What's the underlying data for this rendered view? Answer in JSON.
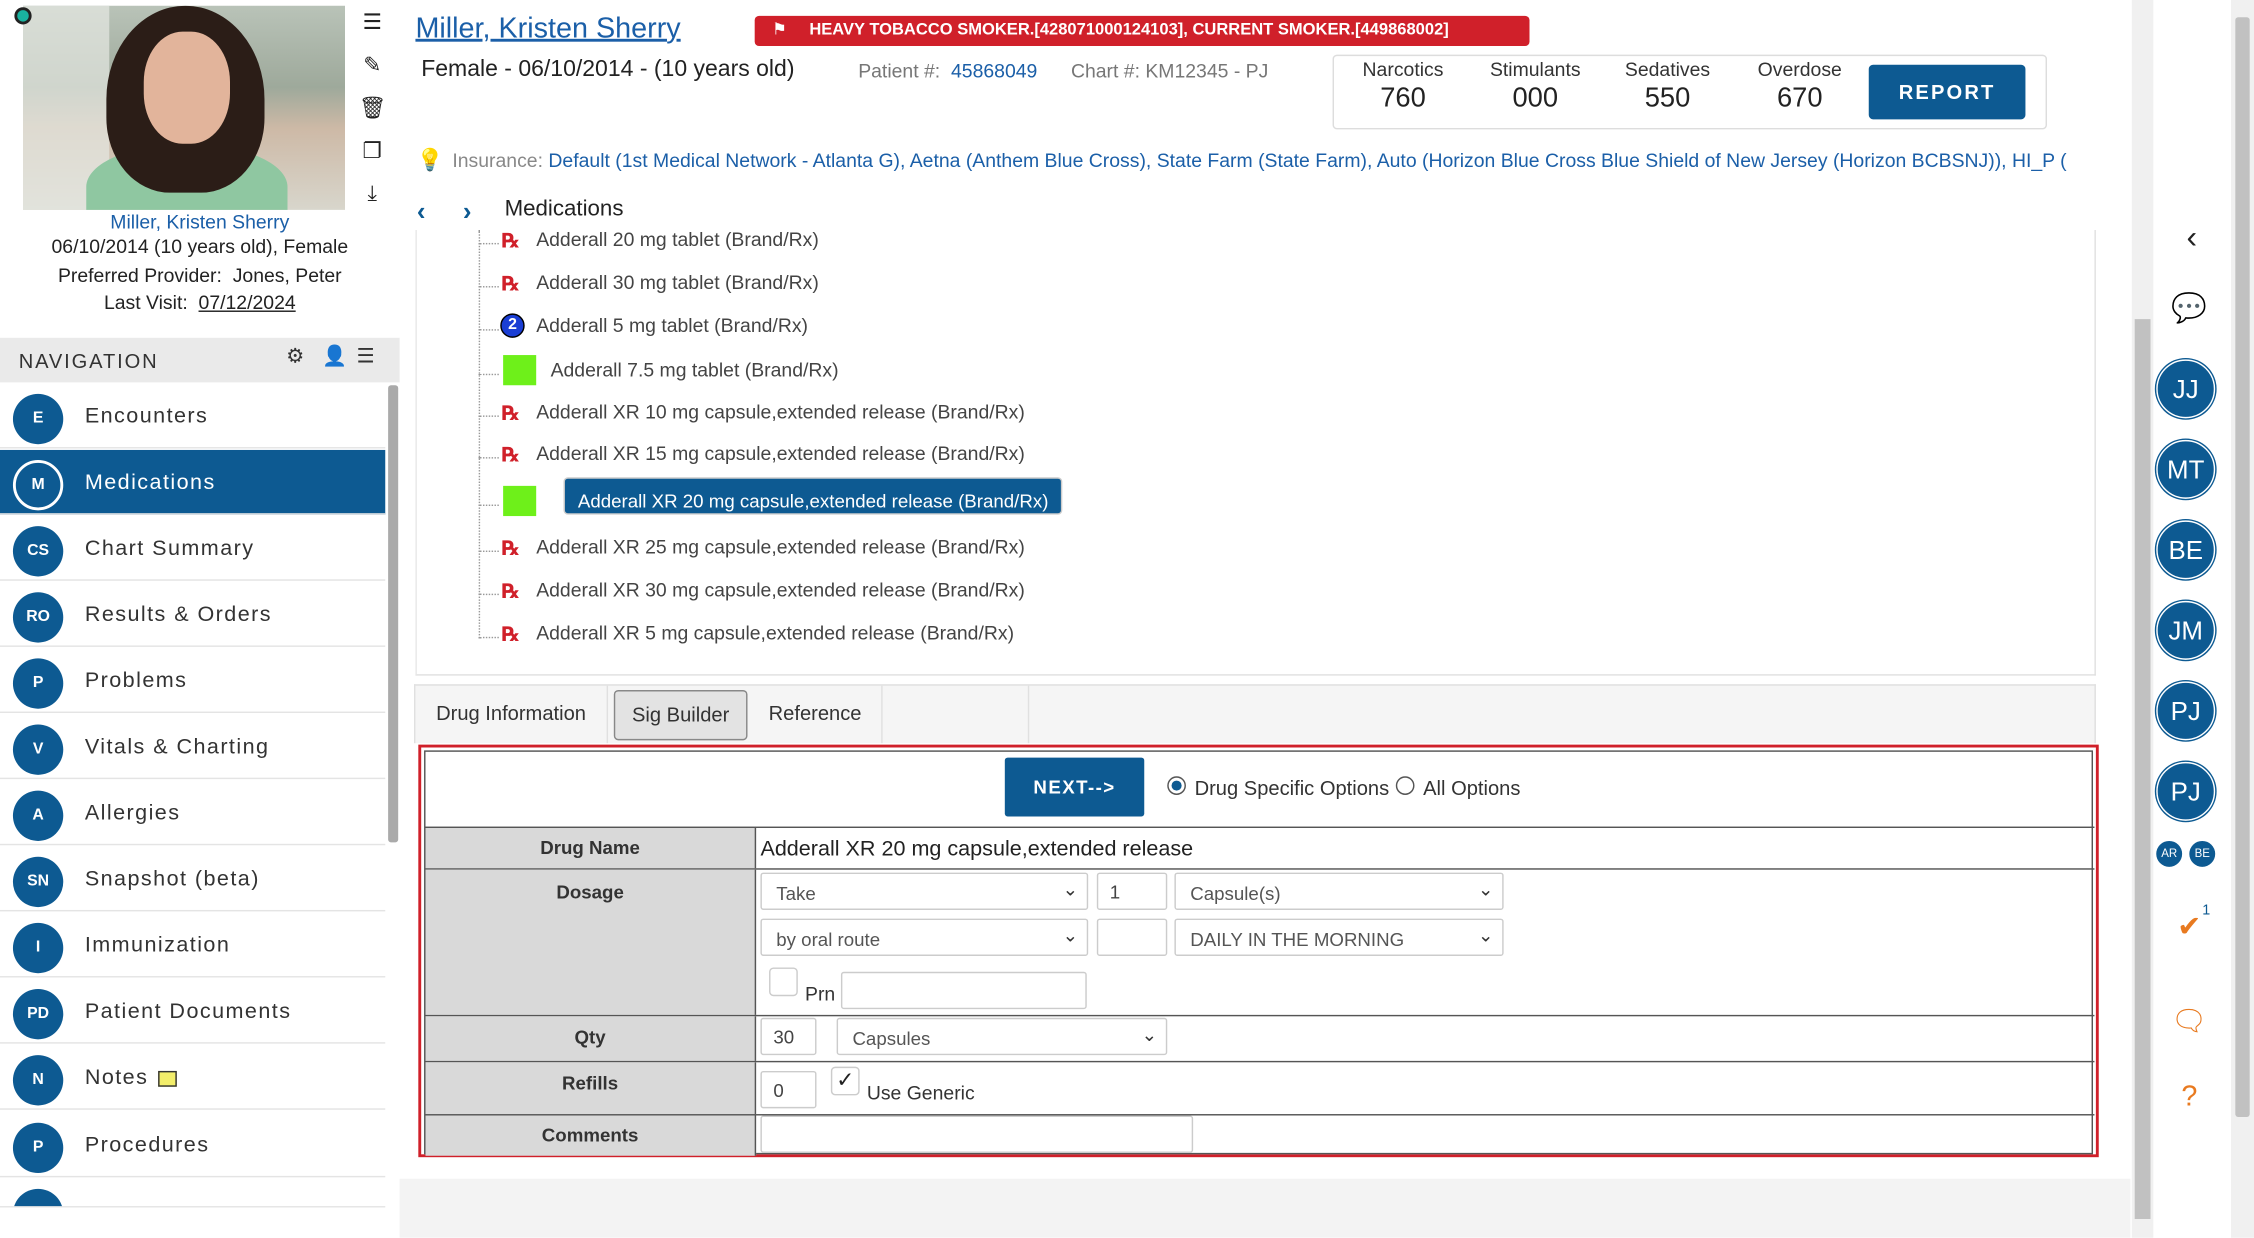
{
  "patient": {
    "name": "Miller, Kristen Sherry",
    "card_name": "Miller, Kristen Sherry",
    "dob_line": "06/10/2014 (10 years old), Female",
    "provider_label": "Preferred Provider:",
    "provider_value": "Jones, Peter",
    "last_visit_label": "Last Visit:",
    "last_visit_value": "07/12/2024",
    "demographics": "Female - 06/10/2014 - (10 years old)",
    "patient_num_label": "Patient #:",
    "patient_num_value": "45868049",
    "chart_num": "Chart #: KM12345 - PJ"
  },
  "flag_text": "HEAVY TOBACCO SMOKER.[428071000124103], CURRENT SMOKER.[449868002]",
  "pdmp": {
    "narcotics_label": "Narcotics",
    "narcotics_value": "760",
    "stimulants_label": "Stimulants",
    "stimulants_value": "000",
    "sedatives_label": "Sedatives",
    "sedatives_value": "550",
    "overdose_label": "Overdose",
    "overdose_value": "670",
    "report_label": "REPORT"
  },
  "insurance": {
    "label": "Insurance:",
    "value": "Default (1st Medical Network - Atlanta G), Aetna (Anthem Blue Cross), State Farm (State Farm), Auto (Horizon Blue Cross Blue Shield of New Jersey (Horizon BCBSNJ)), HI_P ("
  },
  "navigation": {
    "title": "NAVIGATION",
    "items": [
      {
        "abbr": "E",
        "label": "Encounters"
      },
      {
        "abbr": "M",
        "label": "Medications"
      },
      {
        "abbr": "CS",
        "label": "Chart Summary"
      },
      {
        "abbr": "RO",
        "label": "Results & Orders"
      },
      {
        "abbr": "P",
        "label": "Problems"
      },
      {
        "abbr": "V",
        "label": "Vitals & Charting"
      },
      {
        "abbr": "A",
        "label": "Allergies"
      },
      {
        "abbr": "SN",
        "label": "Snapshot (beta)"
      },
      {
        "abbr": "I",
        "label": "Immunization"
      },
      {
        "abbr": "PD",
        "label": "Patient Documents"
      },
      {
        "abbr": "N",
        "label": "Notes"
      },
      {
        "abbr": "P",
        "label": "Procedures"
      }
    ],
    "active": "Medications"
  },
  "medications": {
    "title": "Medications",
    "tree": [
      {
        "label": "Adderall 20 mg tablet (Brand/Rx)",
        "marker": "rx"
      },
      {
        "label": "Adderall 30 mg tablet (Brand/Rx)",
        "marker": "rx"
      },
      {
        "label": "Adderall 5 mg tablet (Brand/Rx)",
        "marker": "count",
        "count": "2"
      },
      {
        "label": "Adderall 7.5 mg tablet (Brand/Rx)",
        "marker": "green"
      },
      {
        "label": "Adderall XR 10 mg capsule,extended release (Brand/Rx)",
        "marker": "rx"
      },
      {
        "label": "Adderall XR 15 mg capsule,extended release (Brand/Rx)",
        "marker": "rx"
      },
      {
        "label": "Adderall XR 20 mg capsule,extended release (Brand/Rx)",
        "marker": "green",
        "selected": true
      },
      {
        "label": "Adderall XR 25 mg capsule,extended release (Brand/Rx)",
        "marker": "rx"
      },
      {
        "label": "Adderall XR 30 mg capsule,extended release (Brand/Rx)",
        "marker": "rx"
      },
      {
        "label": "Adderall XR 5 mg capsule,extended release (Brand/Rx)",
        "marker": "rx"
      }
    ]
  },
  "tabs": [
    "Drug Information",
    "Sig Builder",
    "Reference"
  ],
  "active_tab": "Sig Builder",
  "sig_builder": {
    "next_label": "NEXT-->",
    "option_specific": "Drug Specific Options",
    "option_all": "All Options",
    "selected_option": "Drug Specific Options",
    "drug_name_label": "Drug Name",
    "drug_name_value": "Adderall XR 20 mg capsule,extended release",
    "dosage_label": "Dosage",
    "action": "Take",
    "amount": "1",
    "unit": "Capsule(s)",
    "route": "by oral route",
    "frequency_amount": "",
    "frequency": "DAILY IN THE MORNING",
    "prn_label": "Prn",
    "prn_checked": false,
    "prn_text": "",
    "qty_label": "Qty",
    "qty_value": "30",
    "qty_unit": "Capsules",
    "refills_label": "Refills",
    "refills_value": "0",
    "use_generic_label": "Use Generic",
    "use_generic_checked": true,
    "comments_label": "Comments",
    "comments_value": ""
  },
  "right_panel": {
    "avatars": [
      "JJ",
      "MT",
      "BE",
      "JM",
      "PJ",
      "PJ"
    ],
    "small_avatars": [
      "AR",
      "BE"
    ],
    "task_badge": "1"
  },
  "colors": {
    "primary": "#0d5a92",
    "alert": "#d0202a",
    "green_marker": "#6ef01a",
    "accent_orange": "#e87a20"
  }
}
